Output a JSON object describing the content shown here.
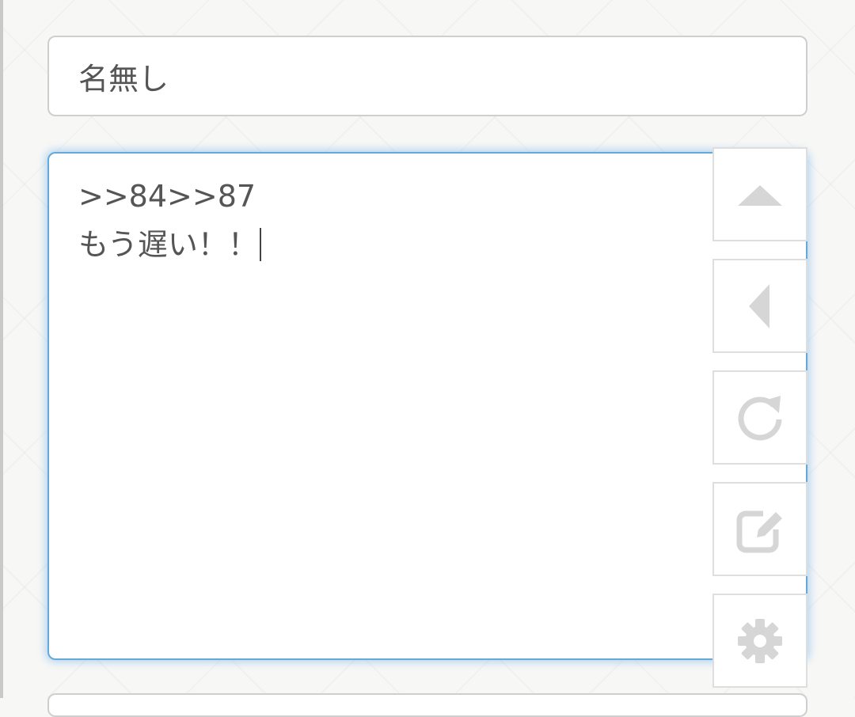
{
  "form": {
    "name_value": "名無し",
    "message_lines": [
      ">>84>>87",
      "もう遅い！！"
    ]
  },
  "side_buttons": [
    {
      "icon": "triangle-up-icon",
      "action": "scroll-top"
    },
    {
      "icon": "triangle-left-icon",
      "action": "back"
    },
    {
      "icon": "refresh-icon",
      "action": "reload"
    },
    {
      "icon": "edit-icon",
      "action": "compose"
    },
    {
      "icon": "gear-icon",
      "action": "settings"
    }
  ],
  "colors": {
    "focus_border": "#66a9d9",
    "icon": "#d6d6d6",
    "text": "#555555"
  }
}
